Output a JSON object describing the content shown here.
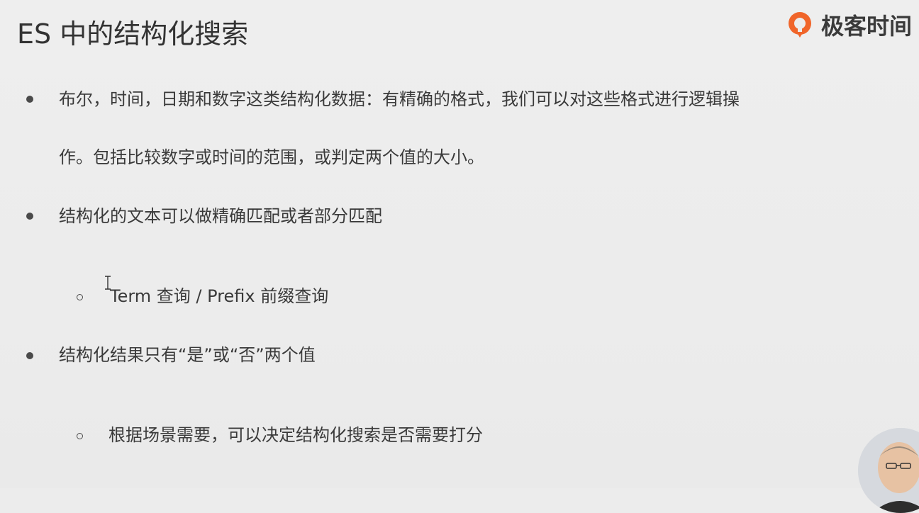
{
  "title": "ES 中的结构化搜索",
  "logo": {
    "text": "极客时间",
    "icon": "geektime-logo-icon",
    "accent": "#f0652a"
  },
  "bullets": [
    {
      "line1": "布尔，时间，日期和数字这类结构化数据：有精确的格式，我们可以对这些格式进行逻辑操",
      "line2": "作。包括比较数字或时间的范围，或判定两个值的大小。"
    },
    {
      "line1": "结构化的文本可以做精确匹配或者部分匹配",
      "sub": "Term 查询 / Prefix 前缀查询"
    },
    {
      "line1": "结构化结果只有“是”或“否”两个值",
      "sub": "根据场景需要，可以决定结构化搜索是否需要打分"
    }
  ],
  "cursor": "text-cursor-icon",
  "presenter": "presenter-video-thumbnail"
}
